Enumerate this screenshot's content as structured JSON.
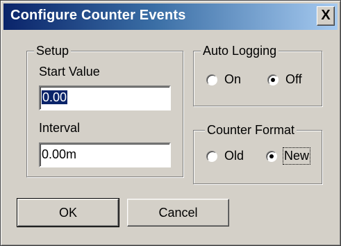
{
  "window": {
    "title": "Configure Counter Events",
    "close_glyph": "X"
  },
  "setup": {
    "legend": "Setup",
    "start_value_label": "Start Value",
    "start_value": "0.00",
    "interval_label": "Interval",
    "interval_value": "0.00m"
  },
  "auto_logging": {
    "legend": "Auto Logging",
    "options": [
      {
        "label": "On",
        "checked": false
      },
      {
        "label": "Off",
        "checked": true
      }
    ]
  },
  "counter_format": {
    "legend": "Counter Format",
    "options": [
      {
        "label": "Old",
        "checked": false
      },
      {
        "label": "New",
        "checked": true
      }
    ]
  },
  "buttons": {
    "ok_label": "OK",
    "cancel_label": "Cancel"
  }
}
